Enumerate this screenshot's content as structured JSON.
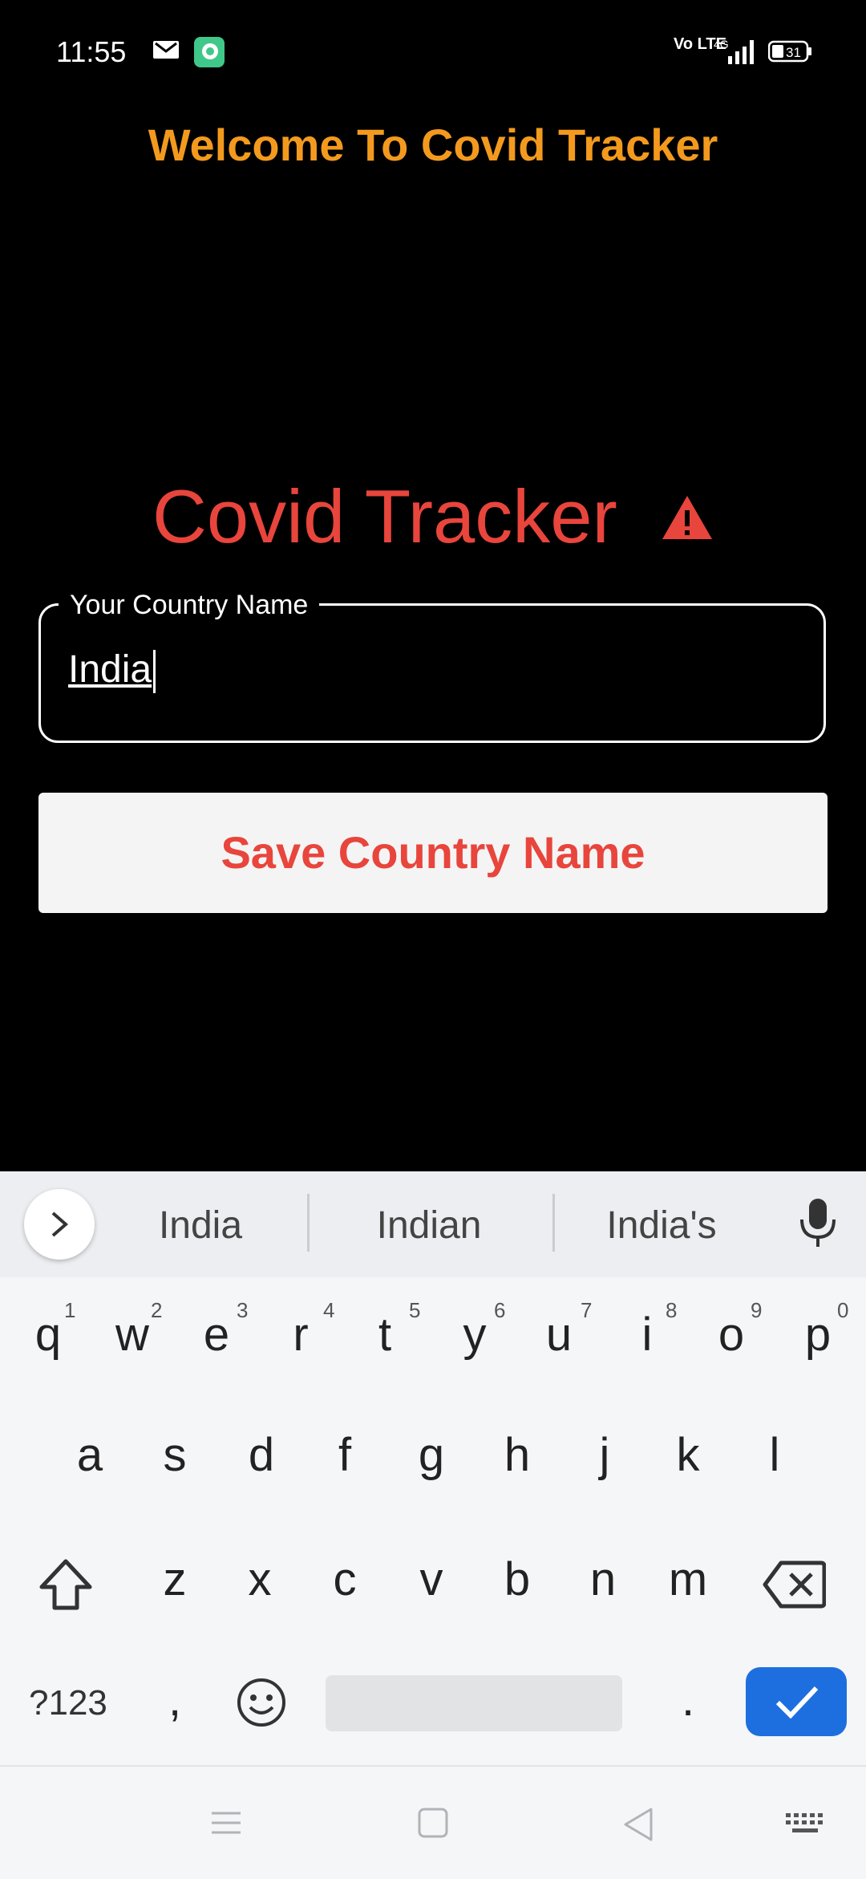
{
  "status_bar": {
    "time": "11:55",
    "battery": "31",
    "network": "4G",
    "volte": "Vo LTE"
  },
  "app": {
    "title": "Welcome To Covid Tracker",
    "hero_title": "Covid Tracker",
    "field_label": "Your Country Name",
    "field_value": "India",
    "save_button": "Save Country Name"
  },
  "keyboard": {
    "suggestions": [
      "India",
      "Indian",
      "India's"
    ],
    "row1": [
      "q",
      "w",
      "e",
      "r",
      "t",
      "y",
      "u",
      "i",
      "o",
      "p"
    ],
    "row1_hints": [
      "1",
      "2",
      "3",
      "4",
      "5",
      "6",
      "7",
      "8",
      "9",
      "0"
    ],
    "row2": [
      "a",
      "s",
      "d",
      "f",
      "g",
      "h",
      "j",
      "k",
      "l"
    ],
    "row3": [
      "z",
      "x",
      "c",
      "v",
      "b",
      "n",
      "m"
    ],
    "symbols_key": "?123",
    "comma_key": ",",
    "period_key": "."
  },
  "colors": {
    "title": "#f39a1e",
    "hero": "#e8453c",
    "enter_key": "#1d6fe0"
  }
}
